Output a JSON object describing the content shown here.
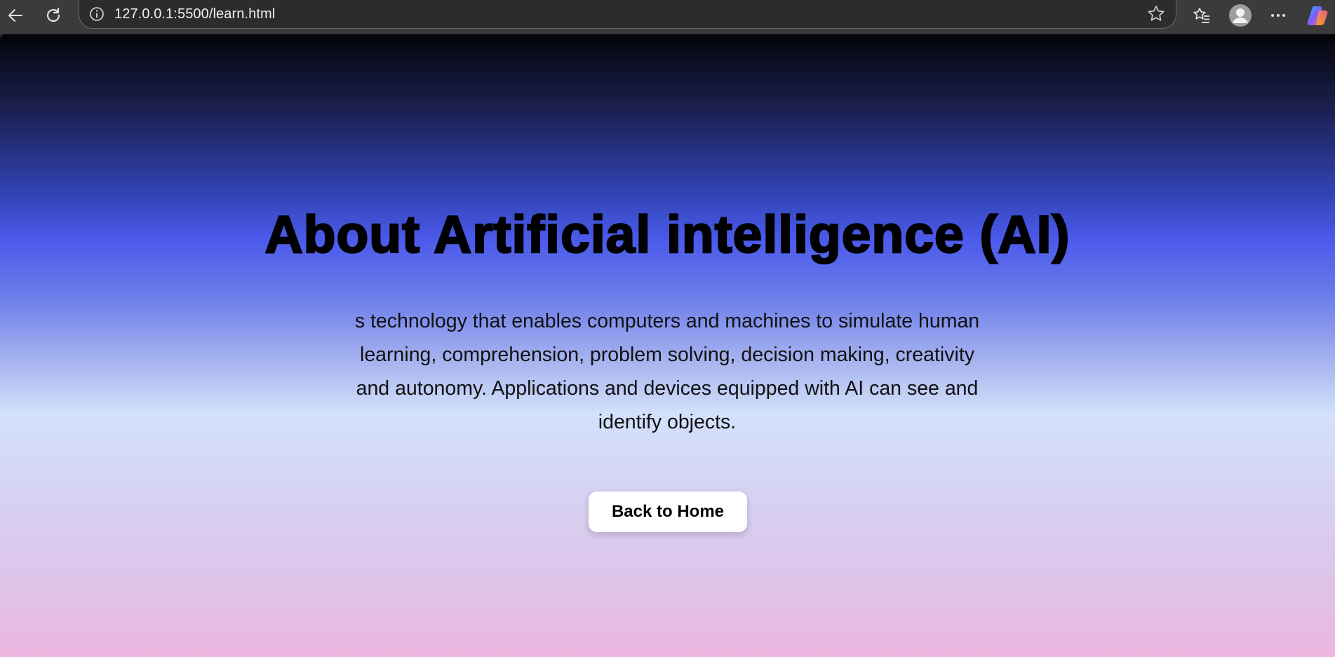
{
  "browser": {
    "url": "127.0.0.1:5500/learn.html",
    "icons": {
      "back": "back-arrow-icon",
      "reload": "reload-icon",
      "info": "info-icon",
      "star": "star-icon",
      "favorites": "favorites-icon",
      "profile": "profile-avatar-icon",
      "more": "more-icon",
      "copilot": "copilot-icon"
    }
  },
  "page": {
    "title": "About Artificial intelligence (AI)",
    "description": "s technology that enables computers and machines to simulate human learning, comprehension, problem solving, decision making, creativity and autonomy. Applications and devices equipped with AI can see and identify objects.",
    "button_label": "Back to Home"
  }
}
